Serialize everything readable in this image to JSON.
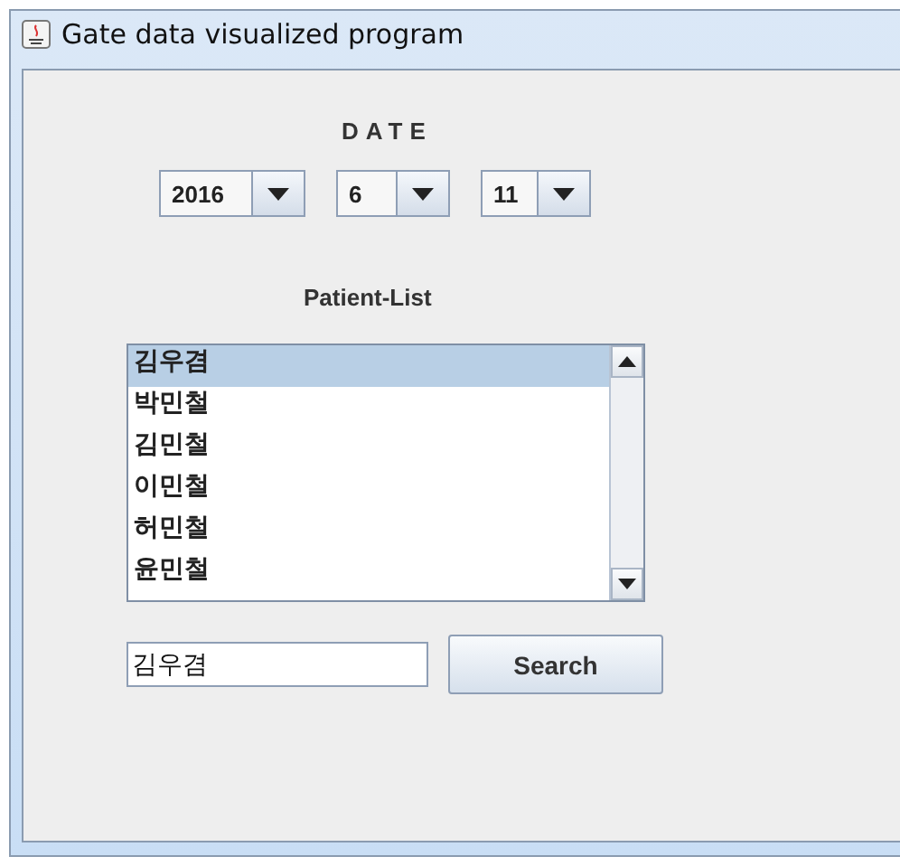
{
  "window": {
    "title": "Gate data visualized program"
  },
  "date": {
    "label": "DATE",
    "combos": [
      {
        "value": "2016"
      },
      {
        "value": "6"
      },
      {
        "value": "11"
      }
    ]
  },
  "patient_list": {
    "label": "Patient-List",
    "items": [
      {
        "name": "김우겸",
        "selected": true
      },
      {
        "name": "박민철",
        "selected": false
      },
      {
        "name": "김민철",
        "selected": false
      },
      {
        "name": "이민철",
        "selected": false
      },
      {
        "name": "허민철",
        "selected": false
      },
      {
        "name": "윤민철",
        "selected": false
      }
    ]
  },
  "search": {
    "value": "김우겸",
    "button": "Search"
  }
}
